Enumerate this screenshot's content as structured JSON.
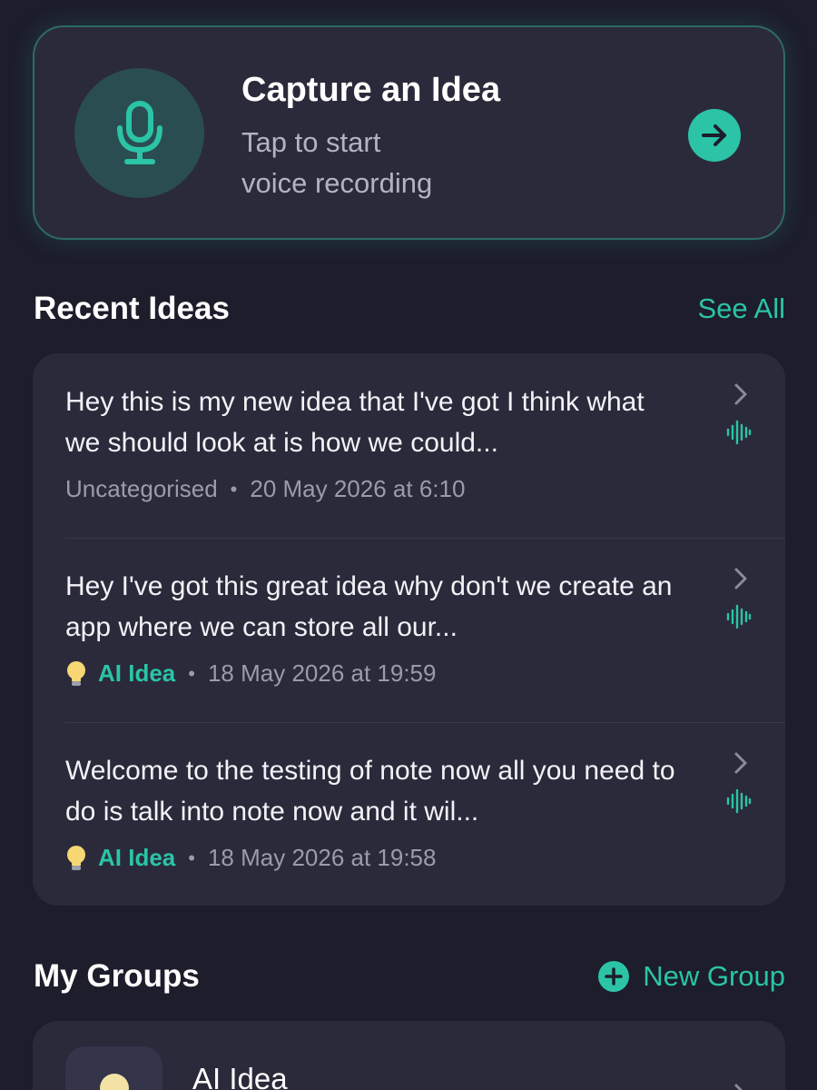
{
  "capture": {
    "title": "Capture an Idea",
    "subtitle": "  Tap to start\nvoice recording",
    "mic_icon": "microphone-icon",
    "arrow_icon": "arrow-right-icon"
  },
  "recent": {
    "title": "Recent Ideas",
    "see_all": "See All",
    "items": [
      {
        "text": "Hey this is my new idea that I've got I think what we should look at is how we could...",
        "category": "Uncategorised",
        "timestamp": "20 May 2026 at 6:10"
      },
      {
        "text": "Hey I've got this great idea why don't we create an app where we can store all our...",
        "category": "AI Idea",
        "timestamp": "18 May 2026 at 19:59"
      },
      {
        "text": "Welcome to the testing of note now all you need to do is talk into note now and it wil...",
        "category": "AI Idea",
        "timestamp": "18 May 2026 at 19:58"
      }
    ]
  },
  "groups": {
    "title": "My Groups",
    "new_group": "New Group",
    "items": [
      {
        "name": "AI Idea",
        "icon": "lightbulb-icon"
      }
    ]
  },
  "colors": {
    "accent": "#2bc4a6",
    "background": "#1d1d2b",
    "card": "#2a2a3b"
  }
}
